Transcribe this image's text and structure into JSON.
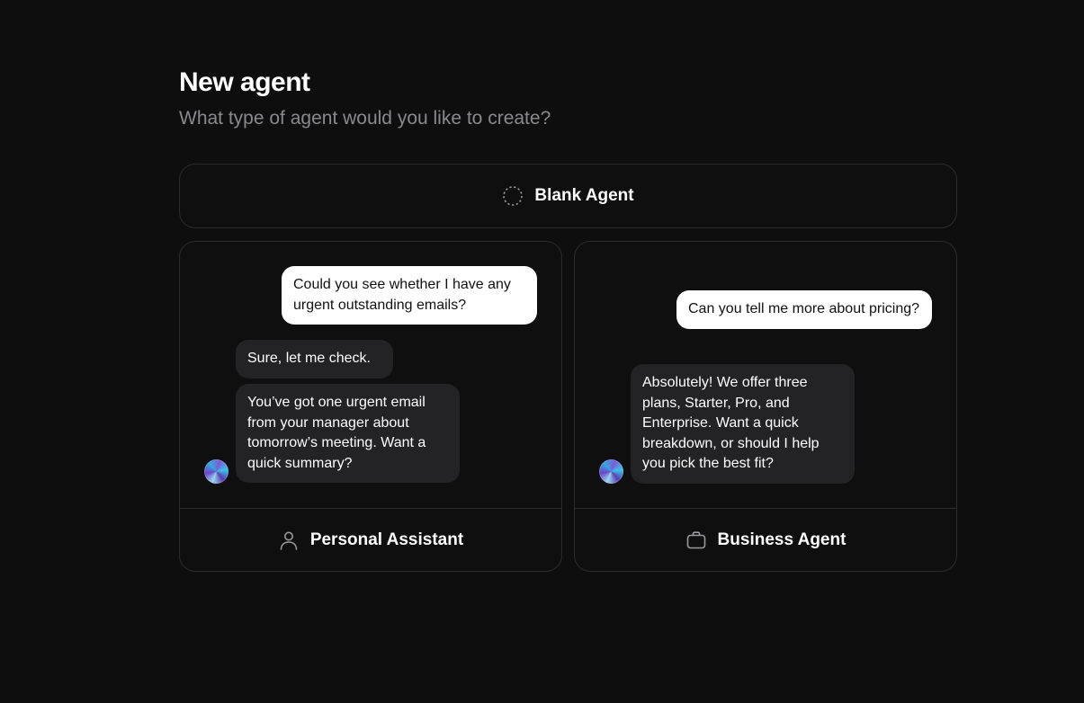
{
  "header": {
    "title": "New agent",
    "subtitle": "What type of agent would you like to create?"
  },
  "blank_agent": {
    "label": "Blank Agent",
    "icon": "dashed-circle-icon"
  },
  "personal_assistant": {
    "label": "Personal Assistant",
    "icon": "user-icon",
    "messages": [
      {
        "role": "user",
        "text": "Could you see whether I have any urgent outstanding emails?"
      },
      {
        "role": "assistant",
        "text": "Sure, let me check."
      },
      {
        "role": "assistant",
        "text": "You’ve got one urgent email from your manager about tomorrow’s meeting. Want a quick summary?"
      }
    ]
  },
  "business_agent": {
    "label": "Business Agent",
    "icon": "briefcase-icon",
    "messages": [
      {
        "role": "user",
        "text": "Can you tell me more about pricing?"
      },
      {
        "role": "assistant",
        "text": "Absolutely! We offer three plans, Starter, Pro, and Enterprise. Want a quick breakdown, or should I help you pick the best fit?"
      }
    ]
  },
  "colors": {
    "background": "#0e0e0e",
    "card_border": "#2c2c2e",
    "user_bubble": "#ffffff",
    "assistant_bubble": "#232325",
    "subtitle": "#8a8a8e"
  }
}
